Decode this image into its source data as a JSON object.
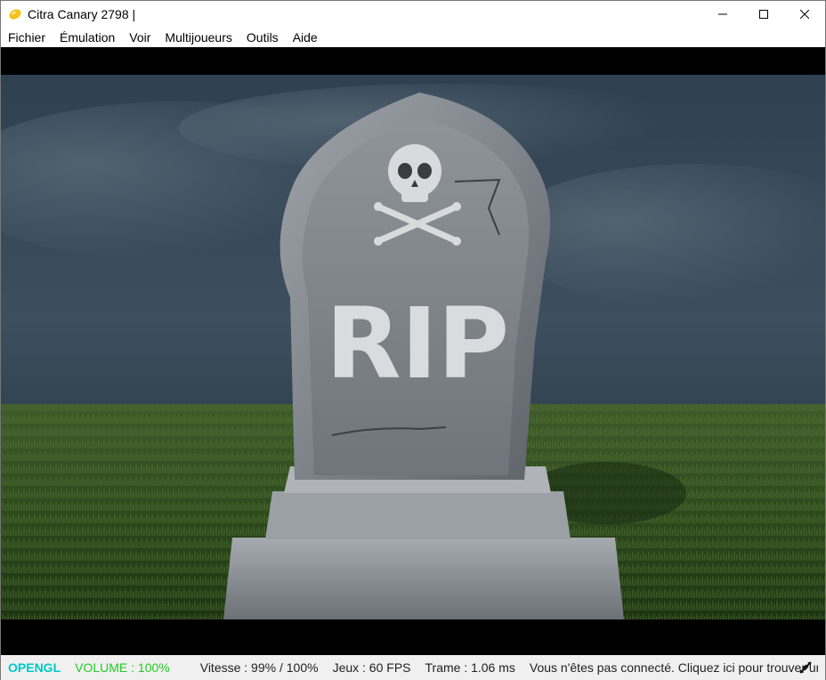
{
  "window": {
    "title": "Citra Canary 2798 |",
    "icon": "citra-lemon-icon",
    "controls": [
      "minimize-icon",
      "maximize-icon",
      "close-icon"
    ]
  },
  "menu": {
    "items": [
      "Fichier",
      "Émulation",
      "Voir",
      "Multijoueurs",
      "Outils",
      "Aide"
    ]
  },
  "screen": {
    "content": "tombstone-image",
    "tombstone_text": "RIP"
  },
  "status": {
    "api": "OPENGL",
    "volume": "VOLUME : 100%",
    "speed": "Vitesse : 99% / 100%",
    "fps": "Jeux : 60 FPS",
    "frame": "Trame : 1.06 ms",
    "network": "Vous n'êtes pas connecté. Cliquez ici pour trouver une salle !",
    "network_icon": "network-disconnected-icon"
  },
  "colors": {
    "api": "#00c8c8",
    "volume": "#22cc22"
  }
}
